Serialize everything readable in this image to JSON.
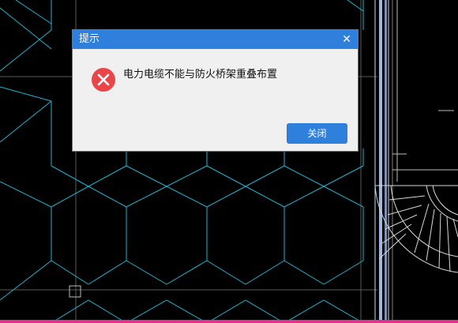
{
  "dialog": {
    "title": "提示",
    "close_glyph": "✕",
    "message": "电力电缆不能与防火桥架重叠布置",
    "icon": "error-circle-icon",
    "button_label": "关闭"
  },
  "colors": {
    "titlebar": "#2f80dc",
    "button": "#2f80dc",
    "error_icon": "#e84649",
    "cad_lines": "#1fb3cf",
    "cad_white_lines": "#d8d8d8",
    "cad_background": "#000000",
    "bottom_edge": "#e0338f"
  }
}
